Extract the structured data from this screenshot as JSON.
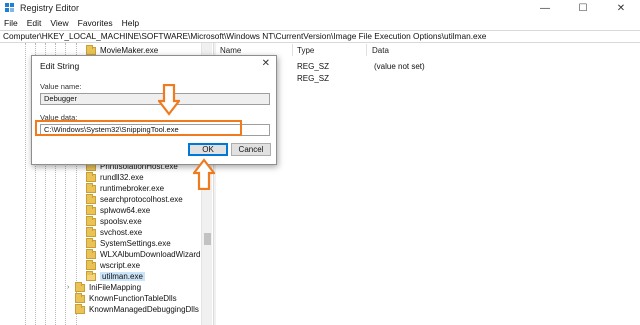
{
  "window": {
    "title": "Registry Editor",
    "controls": {
      "minimize": "—",
      "maximize": "☐",
      "close": "✕"
    }
  },
  "menu": [
    "File",
    "Edit",
    "View",
    "Favorites",
    "Help"
  ],
  "address": "Computer\\HKEY_LOCAL_MACHINE\\SOFTWARE\\Microsoft\\Windows NT\\CurrentVersion\\Image File Execution Options\\utilman.exe",
  "tree": {
    "items": [
      {
        "label": "MovieMaker.exe",
        "level": 2,
        "selected": false
      },
      {
        "label": "PrintIsolationHost.exe",
        "level": 2,
        "selected": false
      },
      {
        "label": "rundll32.exe",
        "level": 2,
        "selected": false
      },
      {
        "label": "runtimebroker.exe",
        "level": 2,
        "selected": false
      },
      {
        "label": "searchprotocolhost.exe",
        "level": 2,
        "selected": false
      },
      {
        "label": "splwow64.exe",
        "level": 2,
        "selected": false
      },
      {
        "label": "spoolsv.exe",
        "level": 2,
        "selected": false
      },
      {
        "label": "svchost.exe",
        "level": 2,
        "selected": false
      },
      {
        "label": "SystemSettings.exe",
        "level": 2,
        "selected": false
      },
      {
        "label": "WLXAlbumDownloadWizard.ex",
        "level": 2,
        "selected": false
      },
      {
        "label": "wscript.exe",
        "level": 2,
        "selected": false
      },
      {
        "label": "utilman.exe",
        "level": 2,
        "selected": true
      },
      {
        "label": "IniFileMapping",
        "level": 1,
        "selected": false
      },
      {
        "label": "KnownFunctionTableDlls",
        "level": 1,
        "selected": false
      },
      {
        "label": "KnownManagedDebuggingDlls",
        "level": 1,
        "selected": false
      }
    ]
  },
  "values_pane": {
    "columns": [
      "Name",
      "Type",
      "Data"
    ],
    "rows": [
      {
        "type": "REG_SZ",
        "data": "(value not set)"
      },
      {
        "type": "REG_SZ",
        "data": ""
      }
    ]
  },
  "dialog": {
    "title": "Edit String",
    "close": "✕",
    "value_name_label": "Value name:",
    "value_name": "Debugger",
    "value_data_label": "Value data:",
    "value_data": "C:\\Windows\\System32\\SnippingTool.exe",
    "ok_label": "OK",
    "cancel_label": "Cancel"
  },
  "annotation_color": "#f07b1f"
}
